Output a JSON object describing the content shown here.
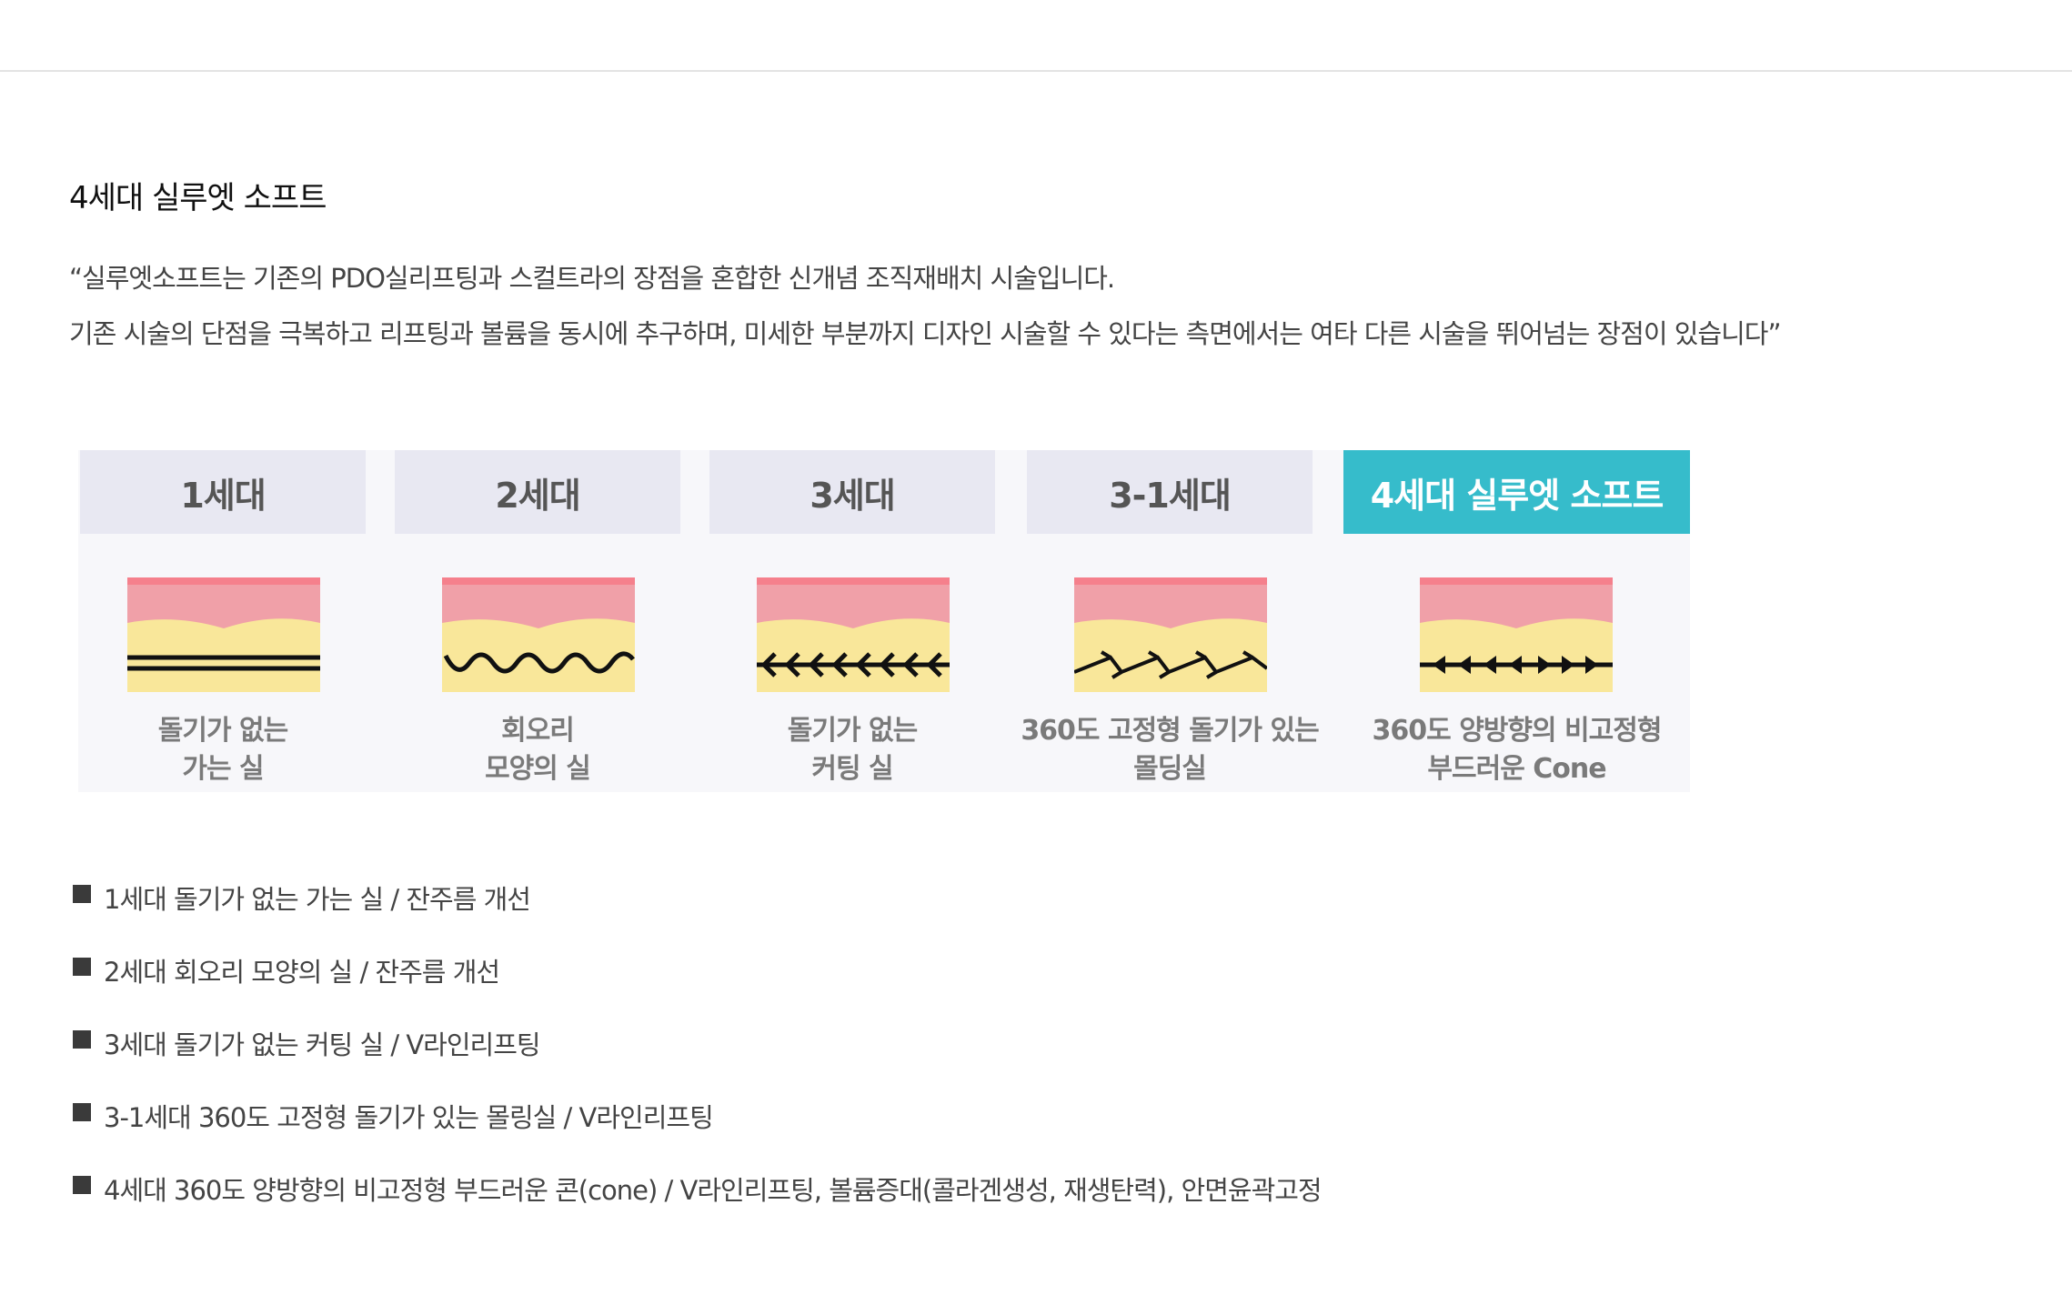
{
  "page": {
    "title": "4세대 실루엣 소프트",
    "intro": [
      "“실루엣소프트는 기존의 PDO실리프팅과 스컬트라의 장점을 혼합한 신개념 조직재배치 시술입니다.",
      "기존 시술의 단점을 극복하고 리프팅과 볼륨을 동시에 추구하며, 미세한 부분까지 디자인 시술할 수 있다는 측면에서는 여타 다른 시술을 뛰어넘는 장점이 있습니다”"
    ]
  },
  "comparison": {
    "colors": {
      "header_bg": "#e8e8f2",
      "active_header_bg": "#36bccb",
      "skin": "#f0a0a8",
      "fat": "#f9e79a",
      "thread": "#111111"
    },
    "generations": [
      {
        "label": "1세대",
        "caption_line1": "돌기가 없는",
        "caption_line2": "가는 실",
        "thread": "double-straight-line",
        "active": false
      },
      {
        "label": "2세대",
        "caption_line1": "회오리",
        "caption_line2": "모양의 실",
        "thread": "wavy-spiral-line",
        "active": false
      },
      {
        "label": "3세대",
        "caption_line1": "돌기가 없는",
        "caption_line2": "커팅 실",
        "thread": "barbed-line",
        "active": false
      },
      {
        "label": "3-1세대",
        "caption_line1": "360도 고정형 돌기가 있는",
        "caption_line2": "몰딩실",
        "thread": "molded-barb-line",
        "active": false
      },
      {
        "label": "4세대 실루엣 소프트",
        "caption_line1": "360도 양방향의 비고정형",
        "caption_line2": "부드러운 Cone",
        "thread": "bidirectional-cone-line",
        "active": true
      }
    ]
  },
  "features": [
    "1세대 돌기가 없는 가는 실 / 잔주름 개선",
    "2세대 회오리 모양의 실 / 잔주름 개선",
    "3세대 돌기가 없는 커팅 실 / V라인리프팅",
    "3-1세대 360도 고정형 돌기가 있는 몰링실 / V라인리프팅",
    "4세대 360도 양방향의 비고정형 부드러운 콘(cone) / V라인리프팅, 볼륨증대(콜라겐생성, 재생탄력), 안면윤곽고정"
  ]
}
